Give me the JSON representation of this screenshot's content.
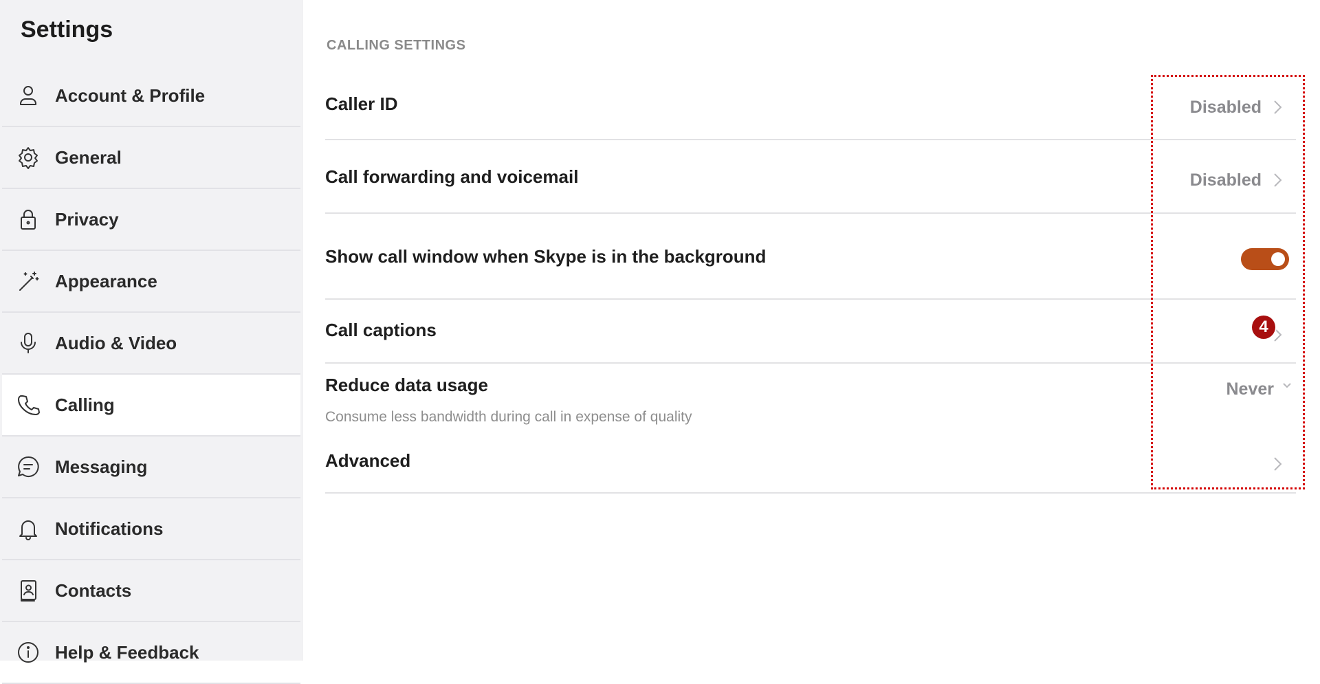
{
  "sidebar": {
    "title": "Settings",
    "items": [
      {
        "label": "Account & Profile",
        "icon": "user-icon"
      },
      {
        "label": "General",
        "icon": "gear-icon"
      },
      {
        "label": "Privacy",
        "icon": "lock-icon"
      },
      {
        "label": "Appearance",
        "icon": "magic-wand-icon"
      },
      {
        "label": "Audio & Video",
        "icon": "microphone-icon"
      },
      {
        "label": "Calling",
        "icon": "phone-icon",
        "active": true
      },
      {
        "label": "Messaging",
        "icon": "chat-icon"
      },
      {
        "label": "Notifications",
        "icon": "bell-icon"
      },
      {
        "label": "Contacts",
        "icon": "contact-book-icon"
      },
      {
        "label": "Help & Feedback",
        "icon": "info-icon"
      }
    ]
  },
  "main": {
    "section_title": "CALLING SETTINGS",
    "rows": {
      "caller_id": {
        "label": "Caller ID",
        "value": "Disabled"
      },
      "call_forwarding": {
        "label": "Call forwarding and voicemail",
        "value": "Disabled"
      },
      "show_call_window": {
        "label": "Show call window when Skype is in the background",
        "toggle_on": true
      },
      "call_captions": {
        "label": "Call captions"
      },
      "reduce_data": {
        "label": "Reduce data usage",
        "description": "Consume less bandwidth during call in expense of quality",
        "value": "Never"
      },
      "advanced": {
        "label": "Advanced"
      }
    }
  },
  "annotation": {
    "badge": "4",
    "color": "#d40000"
  },
  "colors": {
    "accent": "#b94e18",
    "sidebar_bg": "#f2f2f4"
  }
}
